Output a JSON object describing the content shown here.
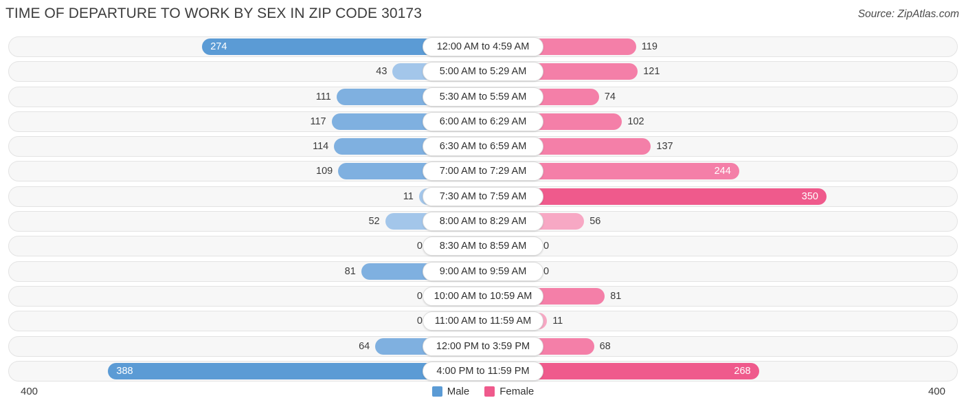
{
  "header": {
    "title": "TIME OF DEPARTURE TO WORK BY SEX IN ZIP CODE 30173",
    "source": "Source: ZipAtlas.com"
  },
  "axis": {
    "left_label": "400",
    "right_label": "400",
    "max": 400
  },
  "legend": {
    "items": [
      {
        "label": "Male",
        "color": "#5b9bd5"
      },
      {
        "label": "Female",
        "color": "#ef5a8c"
      }
    ]
  },
  "colors": {
    "male_light": "#a3c6ea",
    "male_mid": "#7fb0e0",
    "male_dark": "#5b9bd5",
    "female_light": "#f7a8c4",
    "female_mid": "#f47fa8",
    "female_dark": "#ef5a8c",
    "track": "#f7f7f7",
    "track_border": "#e3e3e3"
  },
  "chart_data": {
    "type": "bar",
    "title": "TIME OF DEPARTURE TO WORK BY SEX IN ZIP CODE 30173",
    "subtitle": "",
    "xlabel": "",
    "ylabel": "",
    "orientation": "horizontal-diverging",
    "grid": false,
    "legend_position": "bottom-center",
    "xlim": [
      400,
      400
    ],
    "categories": [
      "12:00 AM to 4:59 AM",
      "5:00 AM to 5:29 AM",
      "5:30 AM to 5:59 AM",
      "6:00 AM to 6:29 AM",
      "6:30 AM to 6:59 AM",
      "7:00 AM to 7:29 AM",
      "7:30 AM to 7:59 AM",
      "8:00 AM to 8:29 AM",
      "8:30 AM to 8:59 AM",
      "9:00 AM to 9:59 AM",
      "10:00 AM to 10:59 AM",
      "11:00 AM to 11:59 AM",
      "12:00 PM to 3:59 PM",
      "4:00 PM to 11:59 PM"
    ],
    "series": [
      {
        "name": "Male",
        "color": "#5b9bd5",
        "side": "left",
        "values": [
          274,
          43,
          111,
          117,
          114,
          109,
          11,
          52,
          0,
          81,
          0,
          0,
          64,
          388
        ]
      },
      {
        "name": "Female",
        "color": "#ef5a8c",
        "side": "right",
        "values": [
          119,
          121,
          74,
          102,
          137,
          244,
          350,
          56,
          0,
          0,
          81,
          11,
          68,
          268
        ]
      }
    ]
  }
}
